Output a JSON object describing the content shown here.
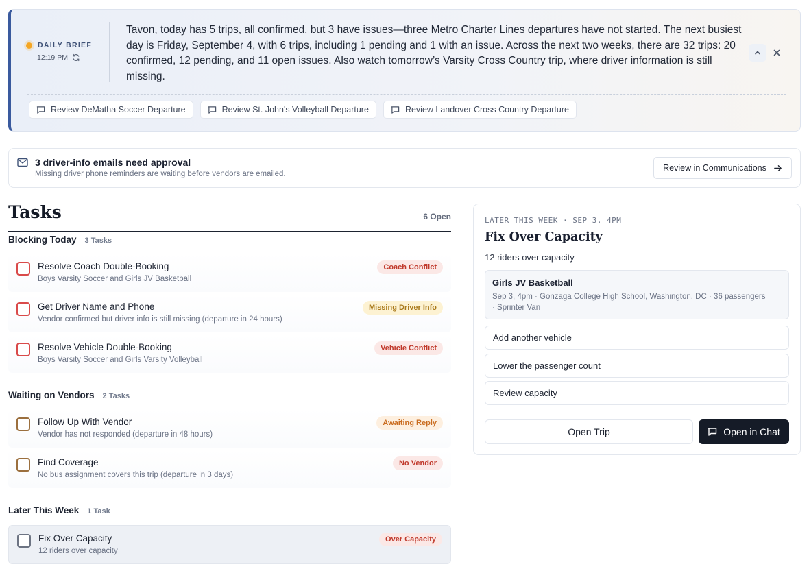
{
  "brief": {
    "label": "DAILY BRIEF",
    "time": "12:19 PM",
    "text": "Tavon, today has 5 trips, all confirmed, but 3 have issues—three Metro Charter Lines departures have not started. The next busiest day is Friday, September 4, with 6 trips, including 1 pending and 1 with an issue. Across the next two weeks, there are 32 trips: 20 confirmed, 12 pending, and 11 open issues. Also watch tomorrow’s Varsity Cross Country trip, where driver information is still missing.",
    "chips": [
      "Review DeMatha Soccer Departure",
      "Review St. John's Volleyball Departure",
      "Review Landover Cross Country Departure"
    ],
    "icons": {
      "status": "status-dot-icon",
      "refresh": "refresh-icon",
      "collapse": "chevron-up-icon",
      "close": "close-icon",
      "chip": "chat-bubble-icon"
    },
    "accent": "#3a5a9e"
  },
  "approval": {
    "title": "3 driver-info emails need approval",
    "subtitle": "Missing driver phone reminders are waiting before vendors are emailed.",
    "button": "Review in Communications"
  },
  "tasks": {
    "title": "Tasks",
    "open_count": "6 Open",
    "groups": [
      {
        "title": "Blocking Today",
        "count": "3 Tasks",
        "items": [
          {
            "title": "Resolve Coach Double-Booking",
            "subtitle": "Boys Varsity Soccer and Girls JV Basketball",
            "badge": "Coach Conflict",
            "badge_color": "#c0392b"
          },
          {
            "title": "Get Driver Name and Phone",
            "subtitle": "Vendor confirmed but driver info is still missing (departure in 24 hours)",
            "badge": "Missing Driver Info",
            "badge_color": "#a9791a"
          },
          {
            "title": "Resolve Vehicle Double-Booking",
            "subtitle": "Boys Varsity Soccer and Girls Varsity Volleyball",
            "badge": "Vehicle Conflict",
            "badge_color": "#c0392b"
          }
        ]
      },
      {
        "title": "Waiting on Vendors",
        "count": "2 Tasks",
        "items": [
          {
            "title": "Follow Up With Vendor",
            "subtitle": "Vendor has not responded (departure in 48 hours)",
            "badge": "Awaiting Reply",
            "badge_color": "#c96b1e"
          },
          {
            "title": "Find Coverage",
            "subtitle": "No bus assignment covers this trip (departure in 3 days)",
            "badge": "No Vendor",
            "badge_color": "#c0392b"
          }
        ]
      },
      {
        "title": "Later This Week",
        "count": "1 Task",
        "items": [
          {
            "title": "Fix Over Capacity",
            "subtitle": "12 riders over capacity",
            "badge": "Over Capacity",
            "badge_color": "#c0392b"
          }
        ]
      }
    ]
  },
  "detail": {
    "eyebrow": "LATER THIS WEEK · SEP 3, 4PM",
    "title": "Fix Over Capacity",
    "subtitle": "12 riders over capacity",
    "trip": {
      "name": "Girls JV Basketball",
      "details": "Sep 3, 4pm · Gonzaga College High School, Washington, DC · 36 passengers · Sprinter Van"
    },
    "options": [
      "Add another vehicle",
      "Lower the passenger count",
      "Review capacity"
    ],
    "open_trip": "Open Trip",
    "open_chat": "Open in Chat"
  }
}
